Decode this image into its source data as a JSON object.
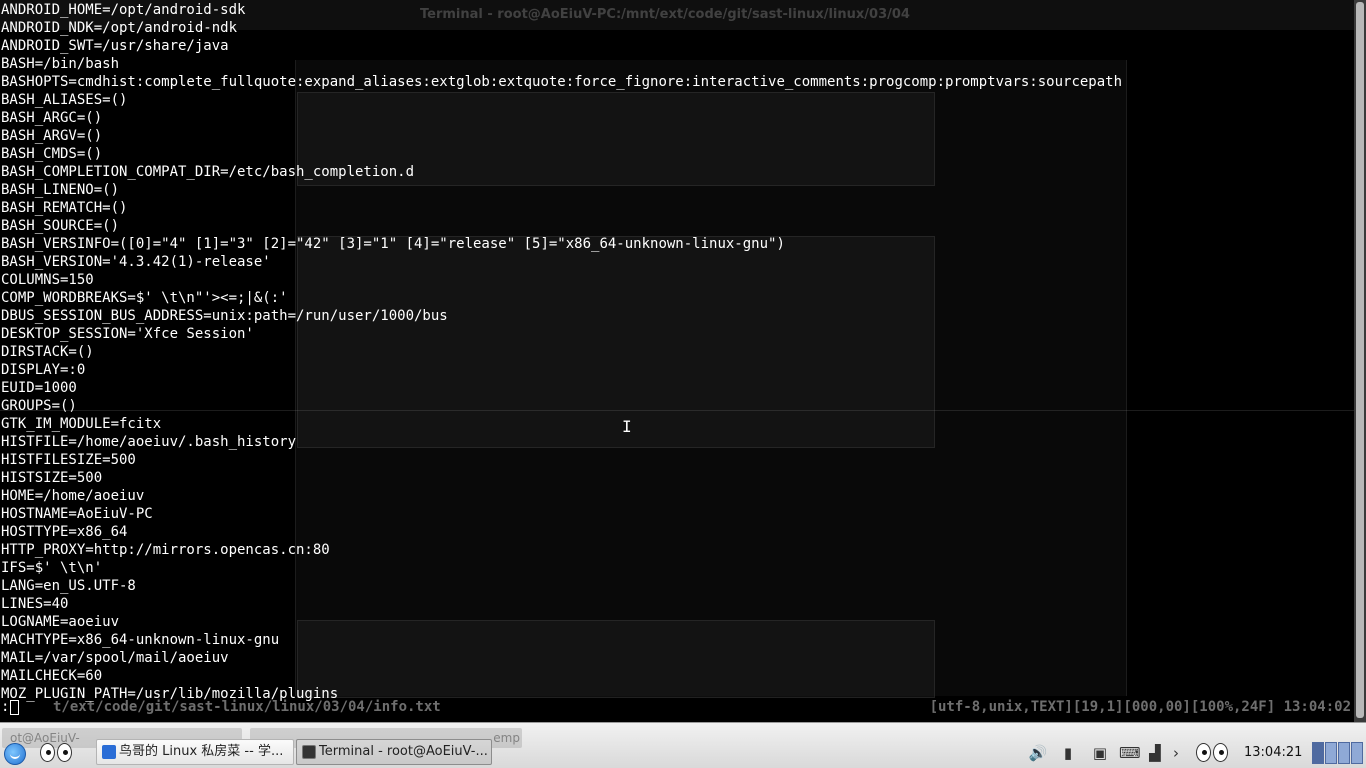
{
  "terminal": {
    "ghost_window_title": "Terminal - root@AoEiuV-PC:/mnt/ext/code/git/sast-linux/linux/03/04",
    "lines": [
      "ANDROID_HOME=/opt/android-sdk",
      "ANDROID_NDK=/opt/android-ndk",
      "ANDROID_SWT=/usr/share/java",
      "BASH=/bin/bash",
      "BASHOPTS=cmdhist:complete_fullquote:expand_aliases:extglob:extquote:force_fignore:interactive_comments:progcomp:promptvars:sourcepath",
      "BASH_ALIASES=()",
      "BASH_ARGC=()",
      "BASH_ARGV=()",
      "BASH_CMDS=()",
      "BASH_COMPLETION_COMPAT_DIR=/etc/bash_completion.d",
      "BASH_LINENO=()",
      "BASH_REMATCH=()",
      "BASH_SOURCE=()",
      "BASH_VERSINFO=([0]=\"4\" [1]=\"3\" [2]=\"42\" [3]=\"1\" [4]=\"release\" [5]=\"x86_64-unknown-linux-gnu\")",
      "BASH_VERSION='4.3.42(1)-release'",
      "COLUMNS=150",
      "COMP_WORDBREAKS=$' \\t\\n\"'><=;|&(:'",
      "DBUS_SESSION_BUS_ADDRESS=unix:path=/run/user/1000/bus",
      "DESKTOP_SESSION='Xfce Session'",
      "DIRSTACK=()",
      "DISPLAY=:0",
      "EUID=1000",
      "GROUPS=()",
      "GTK_IM_MODULE=fcitx",
      "HISTFILE=/home/aoeiuv/.bash_history",
      "HISTFILESIZE=500",
      "HISTSIZE=500",
      "HOME=/home/aoeiuv",
      "HOSTNAME=AoEiuV-PC",
      "HOSTTYPE=x86_64",
      "HTTP_PROXY=http://mirrors.opencas.cn:80",
      "IFS=$' \\t\\n'",
      "LANG=en_US.UTF-8",
      "LINES=40",
      "LOGNAME=aoeiuv",
      "MACHTYPE=x86_64-unknown-linux-gnu",
      "MAIL=/var/spool/mail/aoeiuv",
      "MAILCHECK=60",
      "MOZ_PLUGIN_PATH=/usr/lib/mozilla/plugins"
    ],
    "prompt": ":",
    "status_file": "t/ext/code/git/sast-linux/linux/03/04/info.txt",
    "status_info": "[utf-8,unix,TEXT][19,1][000,00][100%,24F] 13:04:02",
    "text_color": "#ffffff",
    "background_color": "#000000"
  },
  "taskbar": {
    "start_icon": "xfce-menu-icon",
    "ghost_tabs": [
      "ot@AoEiuV-",
      "emp"
    ],
    "buttons": [
      {
        "label": "鸟哥的 Linux 私房菜 -- 学...",
        "icon": "browser-icon",
        "icon_color": "#2a6dd6",
        "active": false
      },
      {
        "label": "Terminal - root@AoEiuV-...",
        "icon": "terminal-icon",
        "icon_color": "#333333",
        "active": true
      }
    ],
    "clock": "13:04:21",
    "tray_icons": [
      "volume-icon",
      "battery-icon",
      "network-icon",
      "keyboard-icon",
      "signal-icon",
      "chevron-right-icon"
    ],
    "accent_color": "#4f6aa0"
  }
}
